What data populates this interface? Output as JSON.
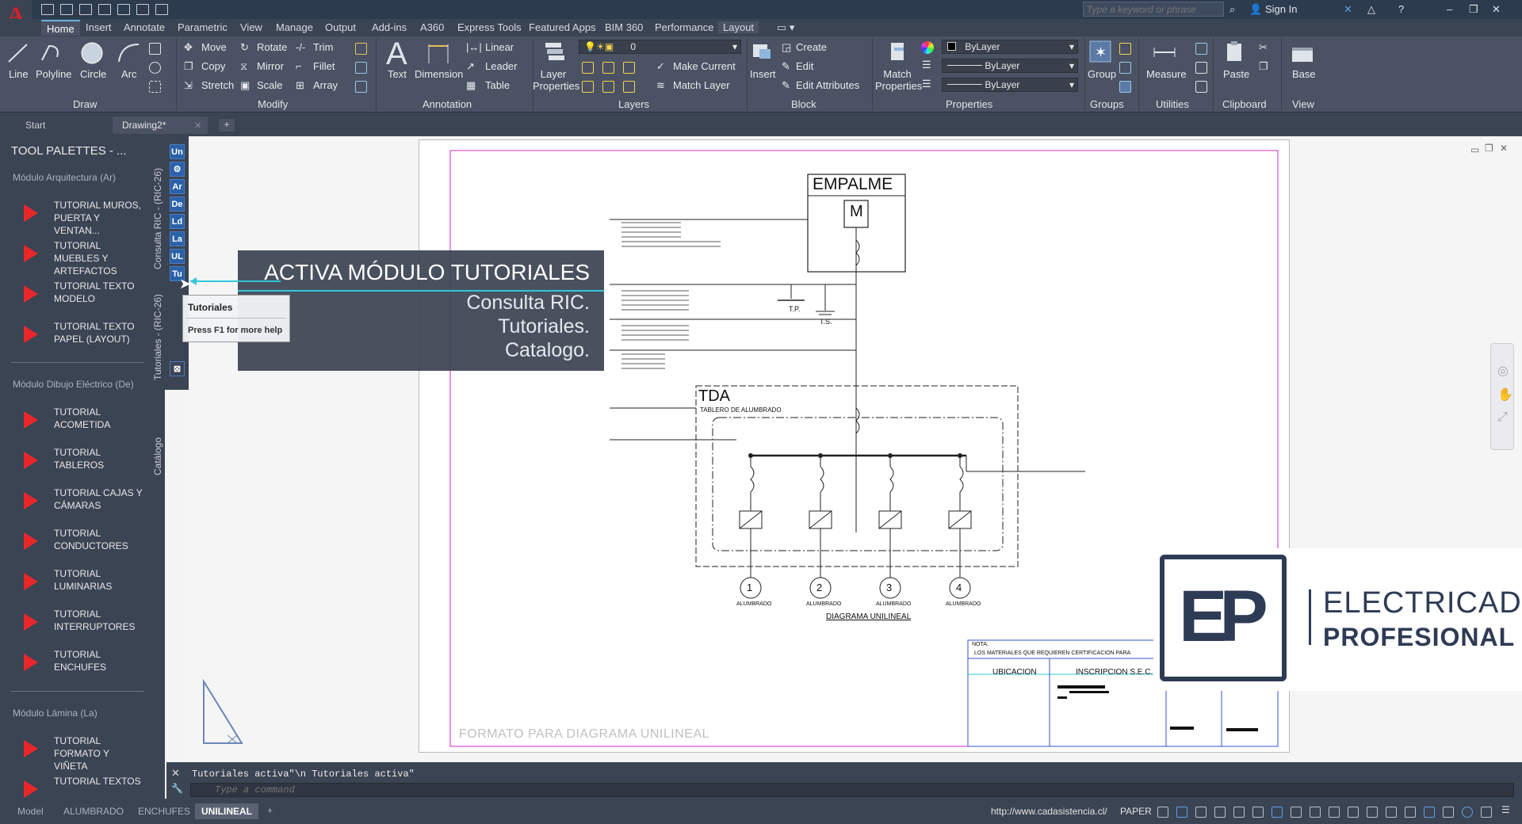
{
  "title_bar": {
    "search_placeholder": "Type a keyword or phrase",
    "sign_in": "Sign In"
  },
  "ribbon_tabs": [
    "Home",
    "Insert",
    "Annotate",
    "Parametric",
    "View",
    "Manage",
    "Output",
    "Add-ins",
    "A360",
    "Express Tools",
    "Featured Apps",
    "BIM 360",
    "Performance",
    "Layout"
  ],
  "ribbon": {
    "draw": {
      "title": "Draw",
      "line": "Line",
      "polyline": "Polyline",
      "circle": "Circle",
      "arc": "Arc"
    },
    "modify": {
      "title": "Modify",
      "move": "Move",
      "rotate": "Rotate",
      "trim": "Trim",
      "copy": "Copy",
      "mirror": "Mirror",
      "fillet": "Fillet",
      "stretch": "Stretch",
      "scale": "Scale",
      "array": "Array"
    },
    "annotation": {
      "title": "Annotation",
      "text": "Text",
      "dimension": "Dimension",
      "linear": "Linear",
      "leader": "Leader",
      "table": "Table"
    },
    "layers": {
      "title": "Layers",
      "layer_properties": "Layer Properties",
      "current_layer": "0",
      "make_current": "Make Current",
      "match_layer": "Match Layer"
    },
    "block": {
      "title": "Block",
      "insert": "Insert",
      "create": "Create",
      "edit": "Edit",
      "edit_attributes": "Edit Attributes"
    },
    "properties": {
      "title": "Properties",
      "match_properties": "Match Properties",
      "color": "ByLayer",
      "linetype": "ByLayer",
      "lineweight": "ByLayer"
    },
    "groups": {
      "title": "Groups",
      "group": "Group"
    },
    "utilities": {
      "title": "Utilities",
      "measure": "Measure"
    },
    "clipboard": {
      "title": "Clipboard",
      "paste": "Paste"
    },
    "view": {
      "title": "View",
      "base": "Base"
    }
  },
  "doc_tabs": [
    "Start",
    "Drawing2*"
  ],
  "palette": {
    "title": "TOOL PALETTES - ...",
    "sections": [
      {
        "title": "Módulo Arquitectura (Ar)",
        "items": [
          "TUTORIAL MUROS, PUERTA Y VENTAN...",
          "TUTORIAL MUEBLES Y ARTEFACTOS",
          "TUTORIAL TEXTO MODELO",
          "TUTORIAL TEXTO PAPEL (LAYOUT)"
        ]
      },
      {
        "title": "Módulo Dibujo Eléctrico (De)",
        "items": [
          "TUTORIAL ACOMETIDA",
          "TUTORIAL TABLEROS",
          "TUTORIAL CAJAS Y CÁMARAS",
          "TUTORIAL CONDUCTORES",
          "TUTORIAL LUMINARIAS",
          "TUTORIAL INTERRUPTORES",
          "TUTORIAL ENCHUFES"
        ]
      },
      {
        "title": "Módulo Lámina (La)",
        "items": [
          "TUTORIAL FORMATO Y VIÑETA",
          "TUTORIAL TEXTOS"
        ]
      }
    ],
    "vertical_tabs": [
      "Consulta RIC - (RIC-26)",
      "Tutoriales - (RIC-26)",
      "Catálogo"
    ],
    "strip_buttons": [
      "Un",
      "⚙",
      "Ar",
      "De",
      "Ld",
      "La",
      "UL",
      "Tu"
    ]
  },
  "tooltip": {
    "title": "Tutoriales",
    "help": "Press F1 for more help"
  },
  "overlay": {
    "title": "ACTIVA MÓDULO TUTORIALES",
    "lines": [
      "Consulta RIC.",
      "Tutoriales.",
      "Catalogo."
    ]
  },
  "drawing": {
    "empalme": "EMPALME",
    "m": "M",
    "tda": "TDA",
    "tda_sub": "TABLERO DE ALUMBRADO",
    "diagram_title": "DIAGRAMA UNILINEAL",
    "format_label": "FORMATO PARA DIAGRAMA UNILINEAL",
    "circuits": [
      "1",
      "2",
      "3",
      "4"
    ],
    "circuit_label": "ALUMBRADO",
    "tp": "T.P.",
    "ts": "T.S.",
    "table_headers": [
      "UBICACION",
      "INSCRIPCION S.E.C."
    ],
    "nota": "NOTA:",
    "nota_text": "LOS MATERIALES QUE REQUIEREN CERTIFICACION PARA"
  },
  "logo": {
    "ep": "EP",
    "line1": "ELECTRICAD",
    "line2": "PROFESIONAL"
  },
  "command": {
    "history": "Tutoriales activa\"\\n Tutoriales activa\"",
    "placeholder": "Type a command"
  },
  "layout_tabs": [
    "Model",
    "ALUMBRADO",
    "ENCHUFES",
    "UNILINEAL"
  ],
  "status": {
    "url": "http://www.cadasistencia.cl/",
    "space": "PAPER"
  },
  "colors": {
    "accent": "#33c6d9",
    "palette_bg": "#3b4453",
    "play": "#e8272a",
    "logo_dark": "#2e3b55",
    "frame_magenta": "#d02bc6"
  }
}
